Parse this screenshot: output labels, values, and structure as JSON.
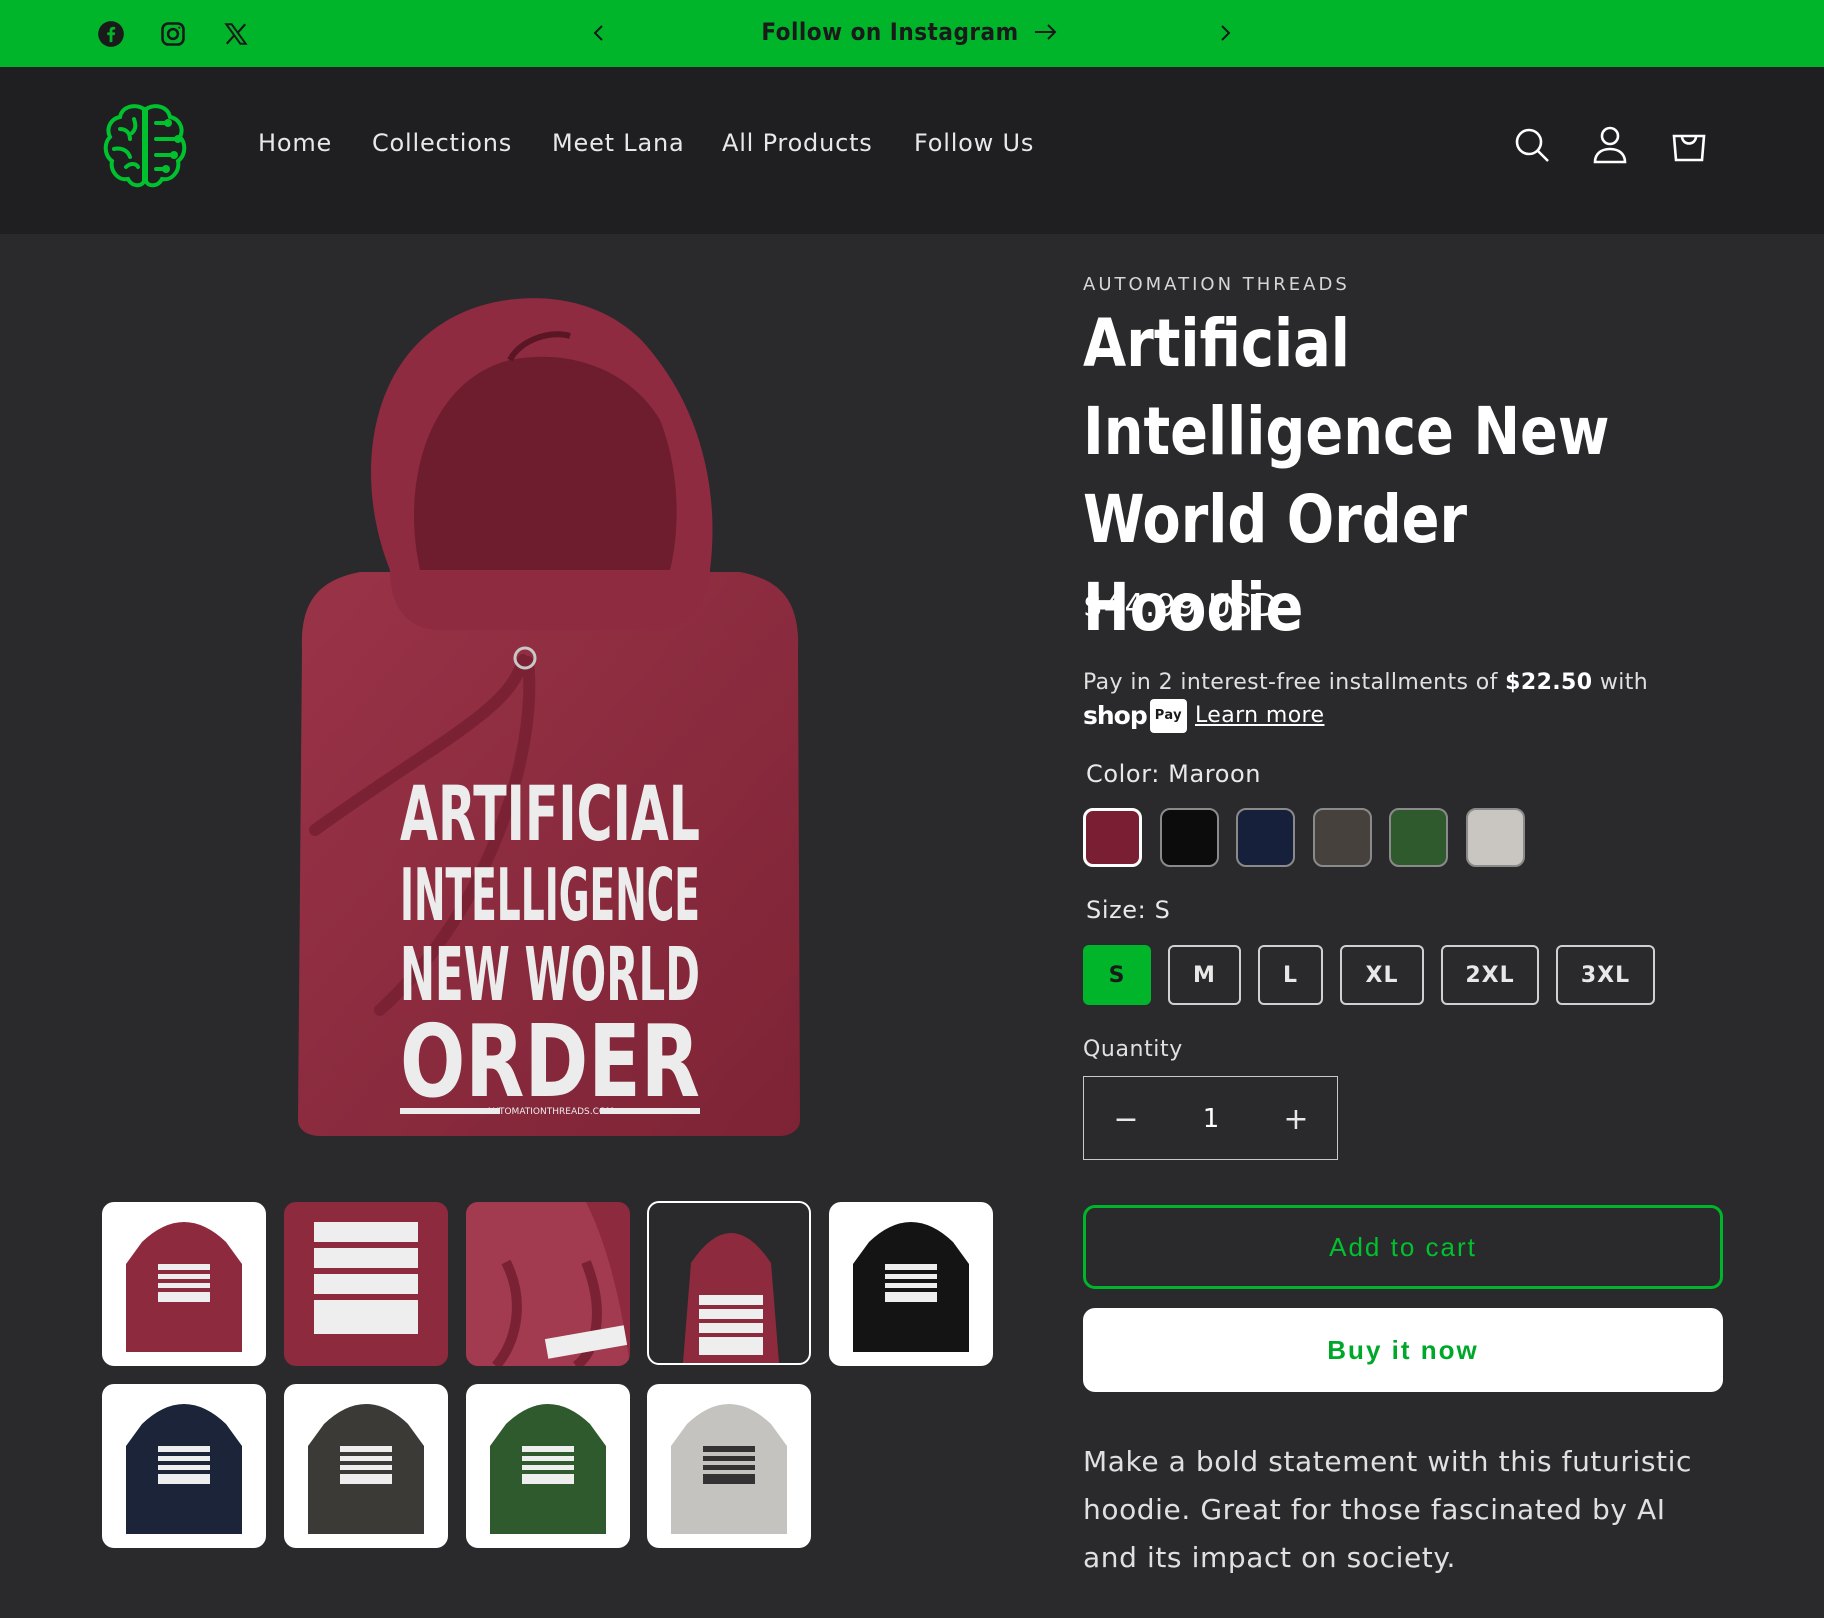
{
  "announcement": {
    "text": "Follow on Instagram",
    "prev_icon": "chevron-left-icon",
    "next_icon": "chevron-right-icon",
    "arrow_icon": "arrow-right-icon",
    "color": "#00b52a"
  },
  "social_icons": [
    "facebook-icon",
    "instagram-icon",
    "x-icon"
  ],
  "nav": {
    "items": [
      "Home",
      "Collections",
      "Meet Lana",
      "All Products",
      "Follow Us"
    ]
  },
  "header_icons": [
    "search-icon",
    "account-icon",
    "cart-icon"
  ],
  "hoodie_print": {
    "line1": "ARTIFICIAL",
    "line2": "INTELLIGENCE",
    "line3": "NEW WORLD",
    "line4": "ORDER",
    "site": "AUTOMATIONTHREADS.COM"
  },
  "gallery": {
    "thumbnail_colors": [
      "#8e2a3e",
      "#8e2a3e",
      "#8e2a3e",
      "#8e2a3e",
      "#141414",
      "#1b2438",
      "#3b3a36",
      "#2f5a2e",
      "#c4c3c0"
    ]
  },
  "product": {
    "vendor": "AUTOMATION THREADS",
    "title": "Artificial Intelligence New World Order Hoodie",
    "price": "$44.99 USD",
    "installments_prefix": "Pay in 2 interest-free installments of ",
    "installment_amount": "$22.50",
    "installments_suffix": " with",
    "shop_logo": "shop",
    "pay_badge": "Pay",
    "learn_more": "Learn more",
    "color_label": "Color: Maroon",
    "colors": [
      {
        "name": "Maroon",
        "hex": "#7a1f33",
        "selected": true
      },
      {
        "name": "Black",
        "hex": "#0c0c0c",
        "selected": false
      },
      {
        "name": "Navy",
        "hex": "#16203a",
        "selected": false
      },
      {
        "name": "Charcoal",
        "hex": "#46413d",
        "selected": false
      },
      {
        "name": "Forest Green",
        "hex": "#2f5a2e",
        "selected": false
      },
      {
        "name": "Heather Grey",
        "hex": "#c9c6c1",
        "selected": false
      }
    ],
    "size_label": "Size: S",
    "sizes": [
      "S",
      "M",
      "L",
      "XL",
      "2XL",
      "3XL"
    ],
    "selected_size": "S",
    "quantity_label": "Quantity",
    "quantity": "1",
    "minus": "−",
    "plus": "+",
    "add_to_cart": "Add to cart",
    "buy_now": "Buy it now",
    "description": "Make a bold statement with this futuristic hoodie. Great for those fascinated by AI and its impact on society."
  }
}
